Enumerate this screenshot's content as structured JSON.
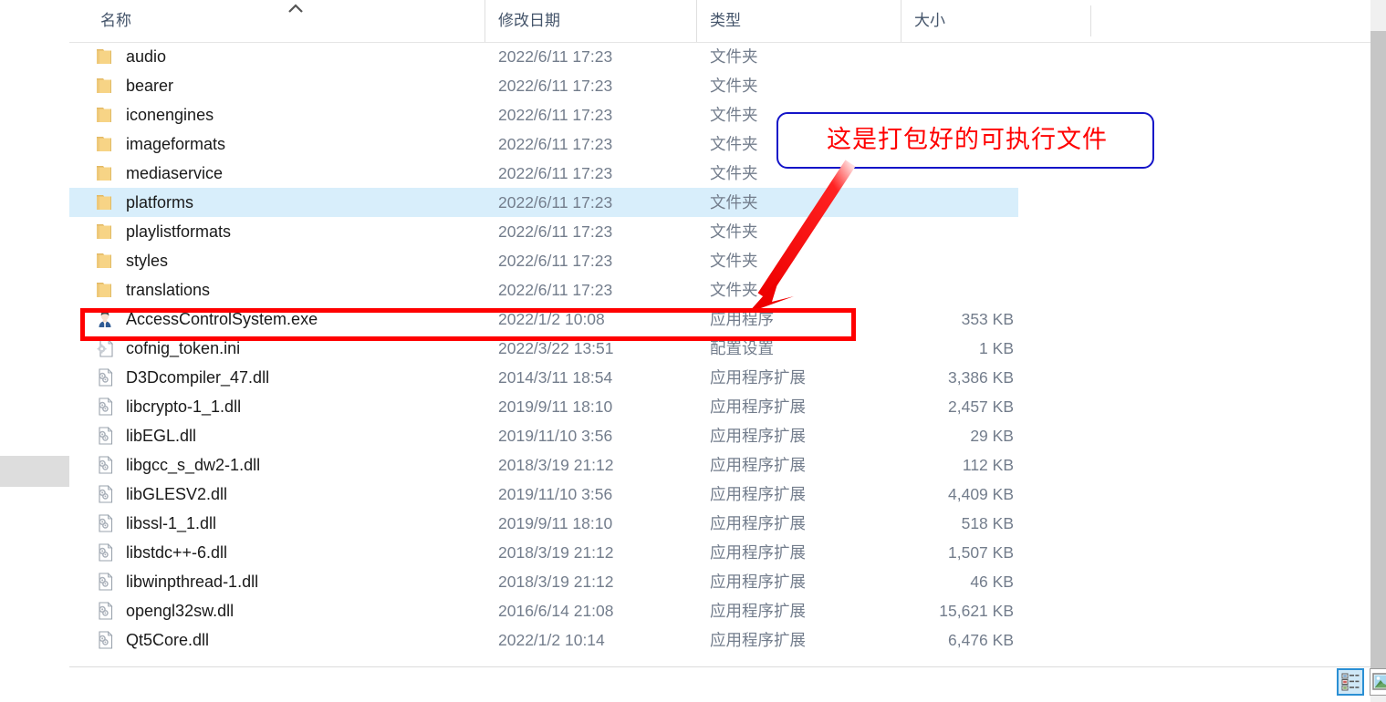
{
  "window": {
    "kind": "windows-file-explorer-details-view"
  },
  "columns": {
    "name": "名称",
    "date_modified": "修改日期",
    "type": "类型",
    "size": "大小",
    "sort_indicator": "ascending"
  },
  "rows": [
    {
      "icon": "folder-icon",
      "name": "audio",
      "date": "2022/6/11 17:23",
      "type": "文件夹",
      "size": "",
      "selected": false
    },
    {
      "icon": "folder-icon",
      "name": "bearer",
      "date": "2022/6/11 17:23",
      "type": "文件夹",
      "size": "",
      "selected": false
    },
    {
      "icon": "folder-icon",
      "name": "iconengines",
      "date": "2022/6/11 17:23",
      "type": "文件夹",
      "size": "",
      "selected": false
    },
    {
      "icon": "folder-icon",
      "name": "imageformats",
      "date": "2022/6/11 17:23",
      "type": "文件夹",
      "size": "",
      "selected": false
    },
    {
      "icon": "folder-icon",
      "name": "mediaservice",
      "date": "2022/6/11 17:23",
      "type": "文件夹",
      "size": "",
      "selected": false
    },
    {
      "icon": "folder-icon",
      "name": "platforms",
      "date": "2022/6/11 17:23",
      "type": "文件夹",
      "size": "",
      "selected": true
    },
    {
      "icon": "folder-icon",
      "name": "playlistformats",
      "date": "2022/6/11 17:23",
      "type": "文件夹",
      "size": "",
      "selected": false
    },
    {
      "icon": "folder-icon",
      "name": "styles",
      "date": "2022/6/11 17:23",
      "type": "文件夹",
      "size": "",
      "selected": false
    },
    {
      "icon": "folder-icon",
      "name": "translations",
      "date": "2022/6/11 17:23",
      "type": "文件夹",
      "size": "",
      "selected": false
    },
    {
      "icon": "person-app-icon",
      "name": "AccessControlSystem.exe",
      "date": "2022/1/2 10:08",
      "type": "应用程序",
      "size": "353 KB",
      "selected": false
    },
    {
      "icon": "ini-gear-icon",
      "name": "cofnig_token.ini",
      "date": "2022/3/22 13:51",
      "type": "配置设置",
      "size": "1 KB",
      "selected": false
    },
    {
      "icon": "dll-icon",
      "name": "D3Dcompiler_47.dll",
      "date": "2014/3/11 18:54",
      "type": "应用程序扩展",
      "size": "3,386 KB",
      "selected": false
    },
    {
      "icon": "dll-icon",
      "name": "libcrypto-1_1.dll",
      "date": "2019/9/11 18:10",
      "type": "应用程序扩展",
      "size": "2,457 KB",
      "selected": false
    },
    {
      "icon": "dll-icon",
      "name": "libEGL.dll",
      "date": "2019/11/10 3:56",
      "type": "应用程序扩展",
      "size": "29 KB",
      "selected": false
    },
    {
      "icon": "dll-icon",
      "name": "libgcc_s_dw2-1.dll",
      "date": "2018/3/19 21:12",
      "type": "应用程序扩展",
      "size": "112 KB",
      "selected": false
    },
    {
      "icon": "dll-icon",
      "name": "libGLESV2.dll",
      "date": "2019/11/10 3:56",
      "type": "应用程序扩展",
      "size": "4,409 KB",
      "selected": false
    },
    {
      "icon": "dll-icon",
      "name": "libssl-1_1.dll",
      "date": "2019/9/11 18:10",
      "type": "应用程序扩展",
      "size": "518 KB",
      "selected": false
    },
    {
      "icon": "dll-icon",
      "name": "libstdc++-6.dll",
      "date": "2018/3/19 21:12",
      "type": "应用程序扩展",
      "size": "1,507 KB",
      "selected": false
    },
    {
      "icon": "dll-icon",
      "name": "libwinpthread-1.dll",
      "date": "2018/3/19 21:12",
      "type": "应用程序扩展",
      "size": "46 KB",
      "selected": false
    },
    {
      "icon": "dll-icon",
      "name": "opengl32sw.dll",
      "date": "2016/6/14 21:08",
      "type": "应用程序扩展",
      "size": "15,621 KB",
      "selected": false
    },
    {
      "icon": "dll-icon",
      "name": "Qt5Core.dll",
      "date": "2022/1/2 10:14",
      "type": "应用程序扩展",
      "size": "6,476 KB",
      "selected": false
    }
  ],
  "annotation": {
    "text": "这是打包好的可执行文件",
    "text_color": "#ff0000",
    "border_color": "#1414c8",
    "arrow_color": "#ff0000",
    "highlight_color": "#ff0000",
    "target_row": "AccessControlSystem.exe"
  },
  "view_buttons": {
    "details": "详细信息视图",
    "large_icons": "大图标视图",
    "active": "details"
  },
  "colors": {
    "selection": "#d8eefb",
    "header_text": "#44546a",
    "secondary_text": "#737d8c",
    "folder_icon": "#f7d486"
  }
}
